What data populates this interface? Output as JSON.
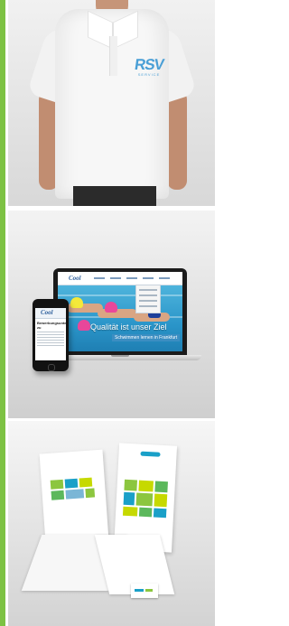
{
  "accent_color": "#7dc243",
  "panel_shirt": {
    "logo_main": "RSV",
    "logo_sub": "SERVICE",
    "logo_color": "#4a9fd6"
  },
  "panel_devices": {
    "laptop": {
      "site_logo": "Cool",
      "hero_title": "Qualität ist unser Ziel",
      "hero_subtitle": "Schwimmen lernen in Frankfurt"
    },
    "phone": {
      "site_logo": "Cool",
      "headline": "Bewerbungsunterlagen zu"
    }
  },
  "panel_stationery": {
    "brand_colors": [
      "#8cc63f",
      "#1aa0c8",
      "#c6d900"
    ]
  }
}
